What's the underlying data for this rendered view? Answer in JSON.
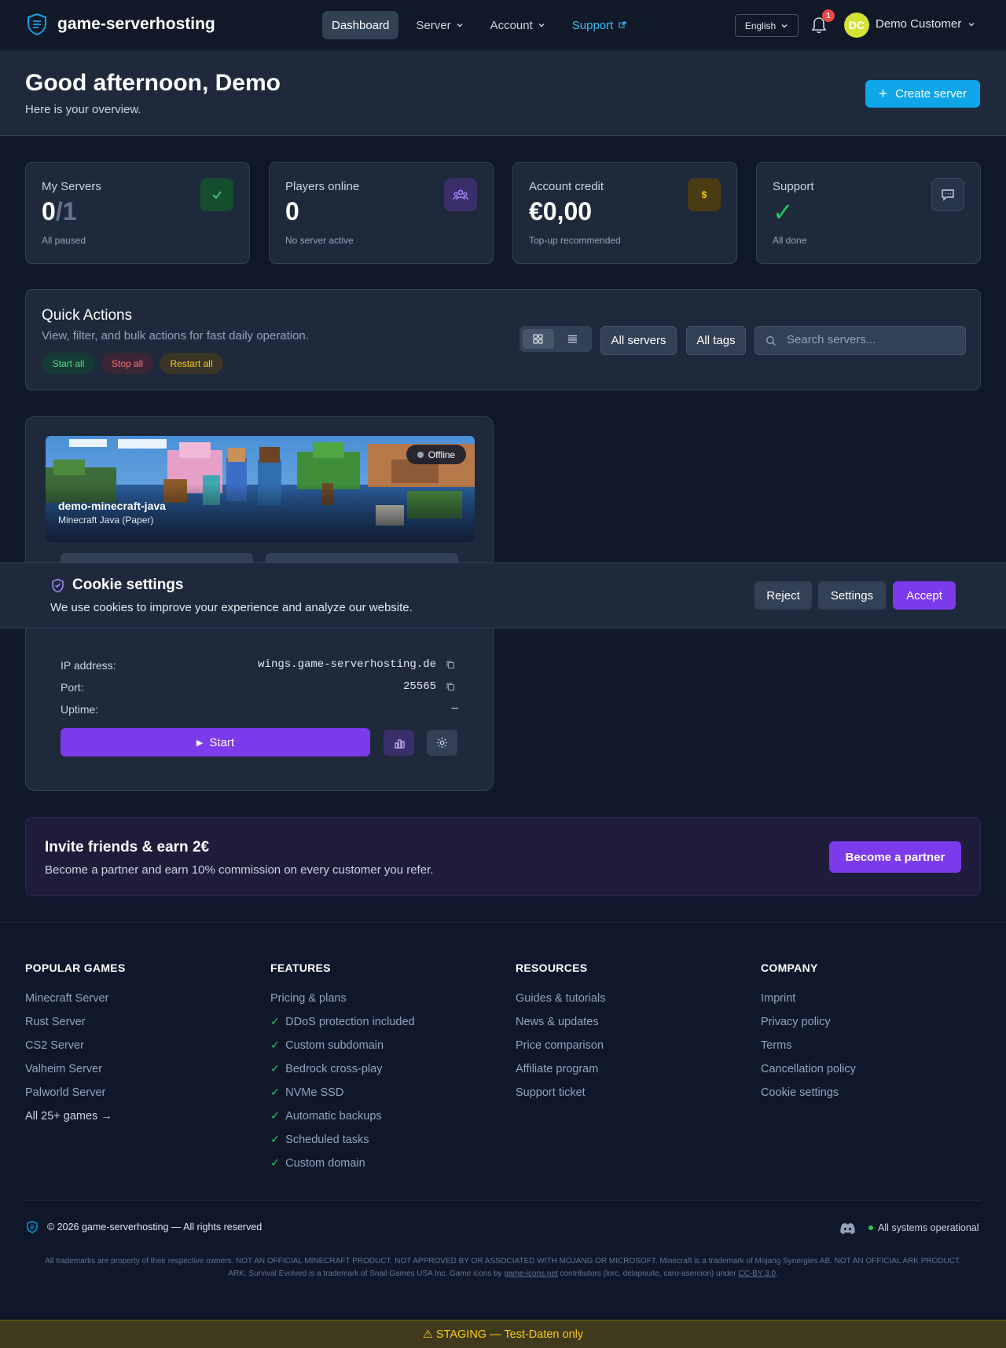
{
  "nav": {
    "brand": "game-serverhosting",
    "links": [
      {
        "label": "Dashboard"
      },
      {
        "label": "Server"
      },
      {
        "label": "Account"
      },
      {
        "label": "Support"
      }
    ],
    "language": "English",
    "notification_count": "1",
    "avatar_initials": "DC",
    "user_name": "Demo Customer"
  },
  "hero": {
    "greeting": "Good afternoon, Demo",
    "subtitle": "Here is your overview.",
    "create_label": "Create server"
  },
  "stats": [
    {
      "label": "My Servers",
      "value": "0",
      "value_total": "/1",
      "sub": "All paused",
      "icon": "check-icon"
    },
    {
      "label": "Players online",
      "value": "0",
      "sub": "No server active",
      "icon": "users-icon"
    },
    {
      "label": "Account credit",
      "value": "€0,00",
      "sub": "Top-up recommended",
      "icon": "dollar-icon"
    },
    {
      "label": "Support",
      "value": "✓",
      "sub": "All done",
      "icon": "chat-icon"
    }
  ],
  "quick_actions": {
    "title": "Quick Actions",
    "subtitle": "View, filter, and bulk actions for fast daily operation.",
    "start_all": "Start all",
    "stop_all": "Stop all",
    "restart_all": "Restart all",
    "filter_servers": "All servers",
    "filter_tags": "All tags",
    "search_placeholder": "Search servers..."
  },
  "server": {
    "name": "demo-minecraft-java",
    "game": "Minecraft Java (Paper)",
    "status": "Offline",
    "ip_label": "IP address:",
    "ip_value": "wings.game-serverhosting.de",
    "port_label": "Port:",
    "port_value": "25565",
    "uptime_label": "Uptime:",
    "uptime_value": "—",
    "start_label": "Start"
  },
  "cookie": {
    "title": "Cookie settings",
    "text": "We use cookies to improve your experience and analyze our website.",
    "reject": "Reject",
    "settings": "Settings",
    "accept": "Accept"
  },
  "invite": {
    "title": "Invite friends & earn 2€",
    "text": "Become a partner and earn 10% commission on every customer you refer.",
    "button": "Become a partner"
  },
  "footer": {
    "popular_games": {
      "heading": "POPULAR GAMES",
      "items": [
        "Minecraft Server",
        "Rust Server",
        "CS2 Server",
        "Valheim Server",
        "Palworld Server",
        "All 25+ games →"
      ]
    },
    "features": {
      "heading": "FEATURES",
      "first": "Pricing & plans",
      "items": [
        "DDoS protection included",
        "Custom subdomain",
        "Bedrock cross-play",
        "NVMe SSD",
        "Automatic backups",
        "Scheduled tasks",
        "Custom domain"
      ]
    },
    "resources": {
      "heading": "RESOURCES",
      "items": [
        "Guides & tutorials",
        "News & updates",
        "Price comparison",
        "Affiliate program",
        "Support ticket"
      ]
    },
    "company": {
      "heading": "COMPANY",
      "items": [
        "Imprint",
        "Privacy policy",
        "Terms",
        "Cancellation policy",
        "Cookie settings"
      ]
    },
    "copyright": "© 2026 game-serverhosting — All rights reserved",
    "status": "All systems operational",
    "disclaimer_1": "All trademarks are property of their respective owners. NOT AN OFFICIAL MINECRAFT PRODUCT. NOT APPROVED BY OR ASSOCIATED WITH MOJANG OR MICROSOFT. Minecraft is a trademark of Mojang Synergies AB. NOT AN OFFICIAL ARK PRODUCT.",
    "disclaimer_2a": "ARK: Survival Evolved is a trademark of Snail Games USA Inc. Game icons by",
    "disclaimer_link1": "game-icons.net",
    "disclaimer_2b": "contributors (lorc, delapouite, caro-asercion) under",
    "disclaimer_link2": "CC-BY 3.0",
    "disclaimer_end": "."
  },
  "staging": "⚠ STAGING — Test-Daten only",
  "colors": {
    "background": "#0f172a",
    "accent_purple": "#7c3aed",
    "accent_blue": "#0ea5e9",
    "success": "#22c55e",
    "staging": "#facc15"
  }
}
